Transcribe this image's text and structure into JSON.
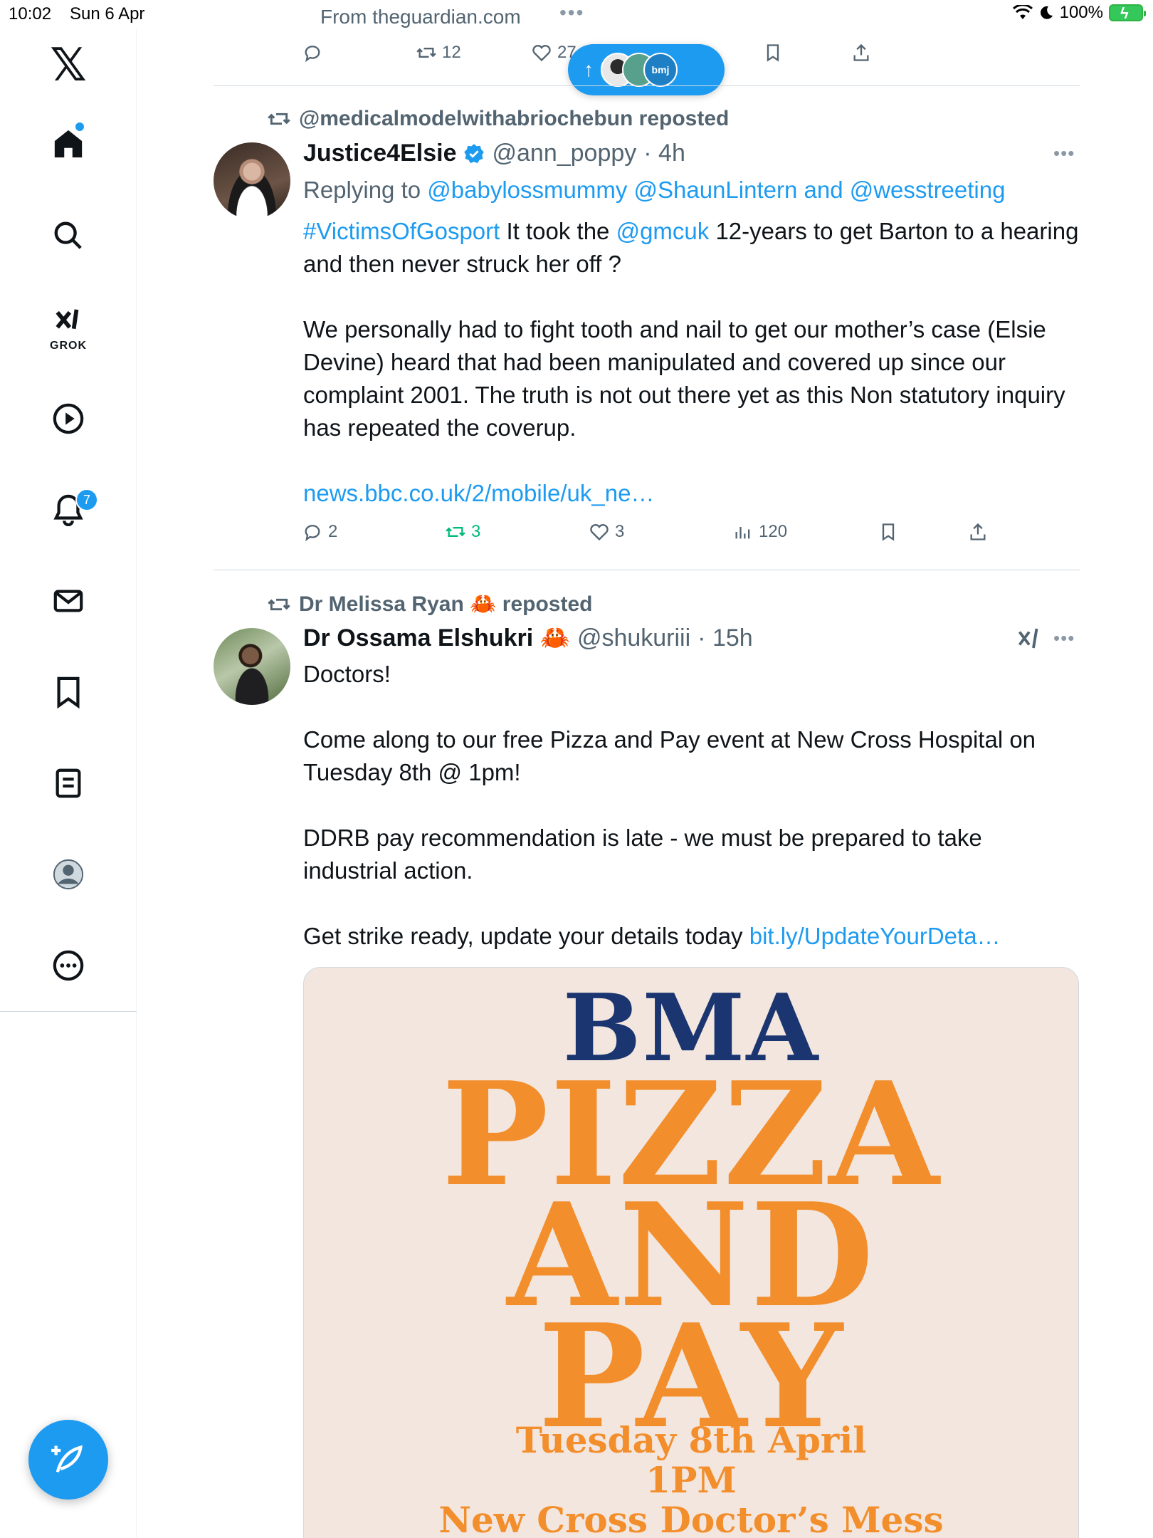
{
  "status_bar": {
    "time": "10:02",
    "date": "Sun 6 Apr",
    "source": "From theguardian.com",
    "dots": "•••",
    "battery": "100%",
    "battery_color": "#34c759"
  },
  "sidebar": {
    "logo": "𝕏",
    "grok_label": "GROK",
    "notifications_count": "7",
    "items": [
      "home-icon",
      "search-icon",
      "grok-icon",
      "video-icon",
      "notifications-icon",
      "messages-icon",
      "bookmarks-icon",
      "lists-icon",
      "profile-icon",
      "more-icon"
    ]
  },
  "top_actions": {
    "retweets": "12",
    "likes": "27"
  },
  "new_posts_pill": {
    "avatar_label": "bmj"
  },
  "tweet1": {
    "repost_by": "@medicalmodelwithabriochebun reposted",
    "name": "Justice4Elsie",
    "handle": "@ann_poppy",
    "time": "· 4h",
    "replying_prefix": "Replying to ",
    "replying_to": "@babylossmummy @ShaunLintern and @wesstreeting",
    "hashtag": "#VictimsOfGosport",
    "text_a": " It took the ",
    "mention": "@gmcuk",
    "text_b": " 12-years to get Barton to a hearing and then never struck her off ?",
    "para2": "We personally had to fight tooth and nail to get our mother’s case (Elsie Devine) heard that had been manipulated and covered up since our complaint 2001. The truth is not out there yet as this Non statutory inquiry has repeated the coverup.",
    "link": "news.bbc.co.uk/2/mobile/uk_ne…",
    "replies": "2",
    "retweets": "3",
    "likes": "3",
    "views": "120"
  },
  "tweet2": {
    "repost_by": "Dr Melissa Ryan 🦀 reposted",
    "name": "Dr Ossama Elshukri 🦀",
    "handle": "@shukuriii",
    "time": "· 15h",
    "para1": "Doctors!",
    "para2": "Come along to our free Pizza and Pay event at New Cross Hospital on Tuesday 8th @ 1pm!",
    "para3": "DDRB pay recommendation is late - we must be prepared to take industrial action.",
    "para4_text": "Get strike ready, update your details today ",
    "para4_link": "bit.ly/UpdateYourDeta…"
  },
  "poster": {
    "line1": "BMA",
    "line2": "PIZZA",
    "line3": "AND",
    "line4": "PAY",
    "line5": "Tuesday 8th April",
    "line6": "1PM",
    "line7": "New Cross Doctor’s Mess",
    "navy": "#1b3570",
    "orange": "#f28e2b",
    "background": "#f3e6df"
  },
  "colors": {
    "accent": "#1d9bf0",
    "muted": "#536471",
    "retweet_active": "#00ba7c"
  }
}
